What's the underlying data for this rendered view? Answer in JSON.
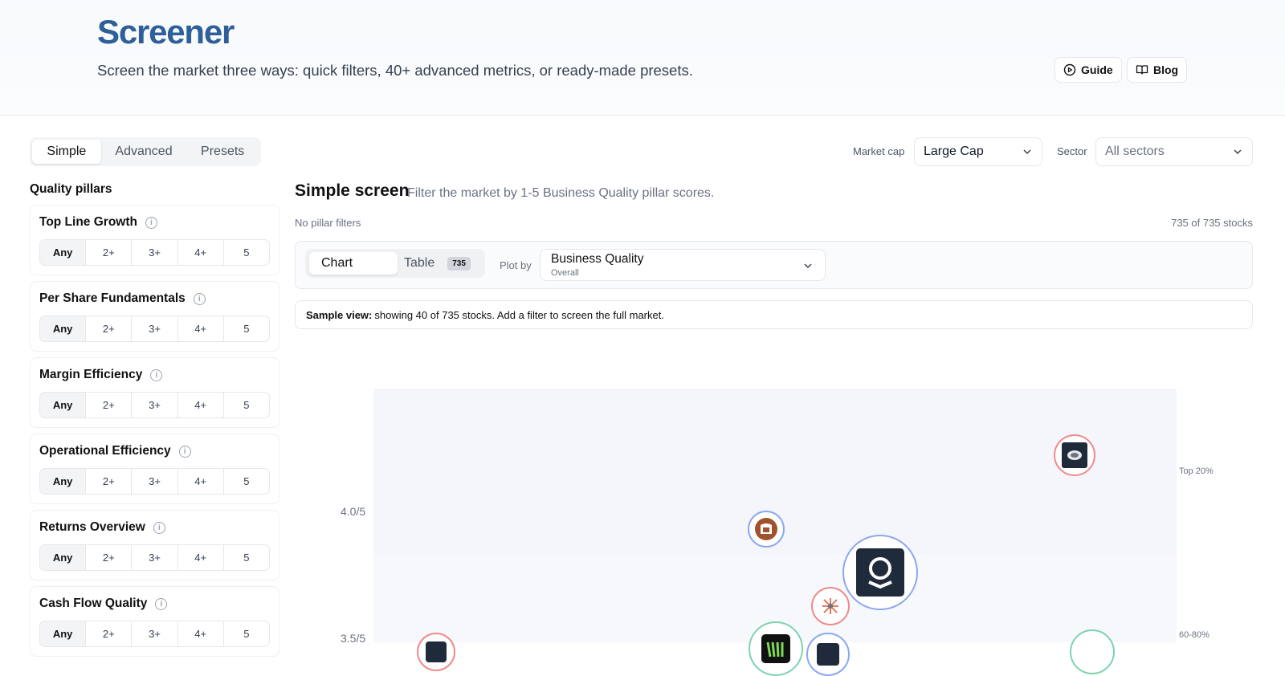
{
  "header": {
    "title": "Screener",
    "subtitle": "Screen the market three ways: quick filters, 40+ advanced metrics, or ready-made presets.",
    "guide_label": "Guide",
    "blog_label": "Blog"
  },
  "mode_tabs": [
    {
      "label": "Simple",
      "active": true
    },
    {
      "label": "Advanced",
      "active": false
    },
    {
      "label": "Presets",
      "active": false
    }
  ],
  "filters": {
    "market_cap_label": "Market cap",
    "market_cap_value": "Large Cap",
    "sector_label": "Sector",
    "sector_placeholder": "All sectors"
  },
  "sidebar": {
    "title": "Quality pillars",
    "options": [
      "Any",
      "2+",
      "3+",
      "4+",
      "5"
    ],
    "pillars": [
      {
        "name": "Top Line Growth",
        "selected": "Any"
      },
      {
        "name": "Per Share Fundamentals",
        "selected": "Any"
      },
      {
        "name": "Margin Efficiency",
        "selected": "Any"
      },
      {
        "name": "Operational Efficiency",
        "selected": "Any"
      },
      {
        "name": "Returns Overview",
        "selected": "Any"
      },
      {
        "name": "Cash Flow Quality",
        "selected": "Any"
      }
    ]
  },
  "main": {
    "title": "Simple screen",
    "subtitle": "Filter the market by 1-5 Business Quality pillar scores.",
    "filters_status": "No pillar filters",
    "count_text": "735 of 735 stocks",
    "view_tabs": {
      "chart": "Chart",
      "table": "Table",
      "table_count": "735"
    },
    "plot_by_label": "Plot by",
    "plot_by_value": "Business Quality",
    "plot_by_sub": "Overall",
    "notice_bold": "Sample view:",
    "notice_text": "showing 40 of 735 stocks. Add a filter to screen the full market."
  },
  "chart_data": {
    "type": "scatter",
    "y_tick_labels": [
      "4.0/5",
      "3.5/5"
    ],
    "tier_labels": [
      "Top 20%",
      "60-80%"
    ],
    "points_visible": 9
  },
  "colors": {
    "title": "#2f5f98",
    "bubble_red": "#f08a8a",
    "bubble_blue": "#8aa7f0",
    "bubble_green": "#7dd3ae"
  }
}
